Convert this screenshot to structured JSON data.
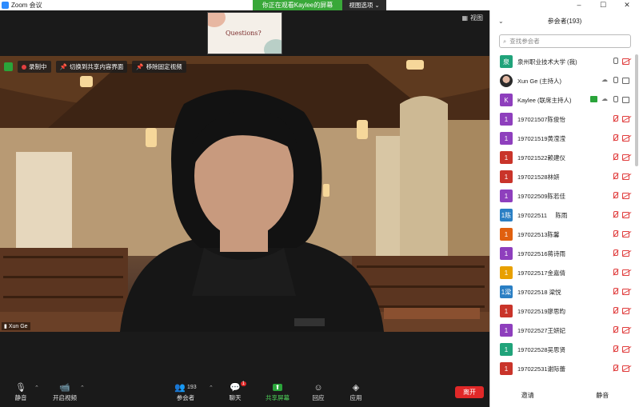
{
  "window": {
    "app_title": "Zoom 会议",
    "share_banner": "你正在观看Kaylee的屏幕",
    "view_options": "视图选项",
    "minimize": "–",
    "maximize": "☐",
    "close": "✕"
  },
  "stage": {
    "view_label": "视图",
    "slide_thumb_text": "Questions?"
  },
  "video": {
    "recording": "录制中",
    "switch_content": "切换到共享内容界面",
    "unpin": "移除固定视频",
    "speaker_name": "Xun Ge"
  },
  "toolbar": {
    "mute": "静音",
    "video": "开启视频",
    "participants": "参会者",
    "participant_count": "193",
    "chat": "聊天",
    "chat_badge": "1",
    "share": "共享屏幕",
    "reactions": "回应",
    "apps": "应用",
    "leave": "离开"
  },
  "panel": {
    "title": "参会者(193)",
    "search_placeholder": "查找参会者",
    "invite": "邀请",
    "mute_all": "静音",
    "participants": [
      {
        "avatar": "泉",
        "color": "#20a37a",
        "name": "泉州职业技术大学 (我)",
        "type": "self"
      },
      {
        "avatar": "",
        "color": "#c97a6a",
        "name": "Xun Ge (主持人)",
        "type": "host"
      },
      {
        "avatar": "K",
        "color": "#8e3fbd",
        "name": "Kaylee (联席主持人)",
        "type": "cohost"
      },
      {
        "avatar": "1",
        "color": "#8e3fbd",
        "name": "197021507陈俊怡",
        "type": "muted"
      },
      {
        "avatar": "1",
        "color": "#8e3fbd",
        "name": "197021519黄滢滢",
        "type": "muted"
      },
      {
        "avatar": "1",
        "color": "#c9342a",
        "name": "197021522赖建仪",
        "type": "muted"
      },
      {
        "avatar": "1",
        "color": "#c9342a",
        "name": "197021528林妍",
        "type": "muted"
      },
      {
        "avatar": "1",
        "color": "#8e3fbd",
        "name": "197022509陈若佳",
        "type": "muted"
      },
      {
        "avatar": "1陈",
        "color": "#2a7fc4",
        "name": "197022511     陈雨",
        "type": "muted"
      },
      {
        "avatar": "1",
        "color": "#e0600f",
        "name": "197022513陈馨",
        "type": "muted"
      },
      {
        "avatar": "1",
        "color": "#8e3fbd",
        "name": "197022516蒋诗雨",
        "type": "muted"
      },
      {
        "avatar": "1",
        "color": "#e8a000",
        "name": "197022517金嘉倩",
        "type": "muted"
      },
      {
        "avatar": "1梁",
        "color": "#2a7fc4",
        "name": "197022518 梁悦",
        "type": "muted"
      },
      {
        "avatar": "1",
        "color": "#c9342a",
        "name": "197022519廖思昀",
        "type": "muted"
      },
      {
        "avatar": "1",
        "color": "#8e3fbd",
        "name": "197022527王妍妃",
        "type": "muted"
      },
      {
        "avatar": "1",
        "color": "#20a37a",
        "name": "197022528吴思贤",
        "type": "muted"
      },
      {
        "avatar": "1",
        "color": "#c9342a",
        "name": "197022531谢际蕾",
        "type": "muted"
      }
    ]
  }
}
